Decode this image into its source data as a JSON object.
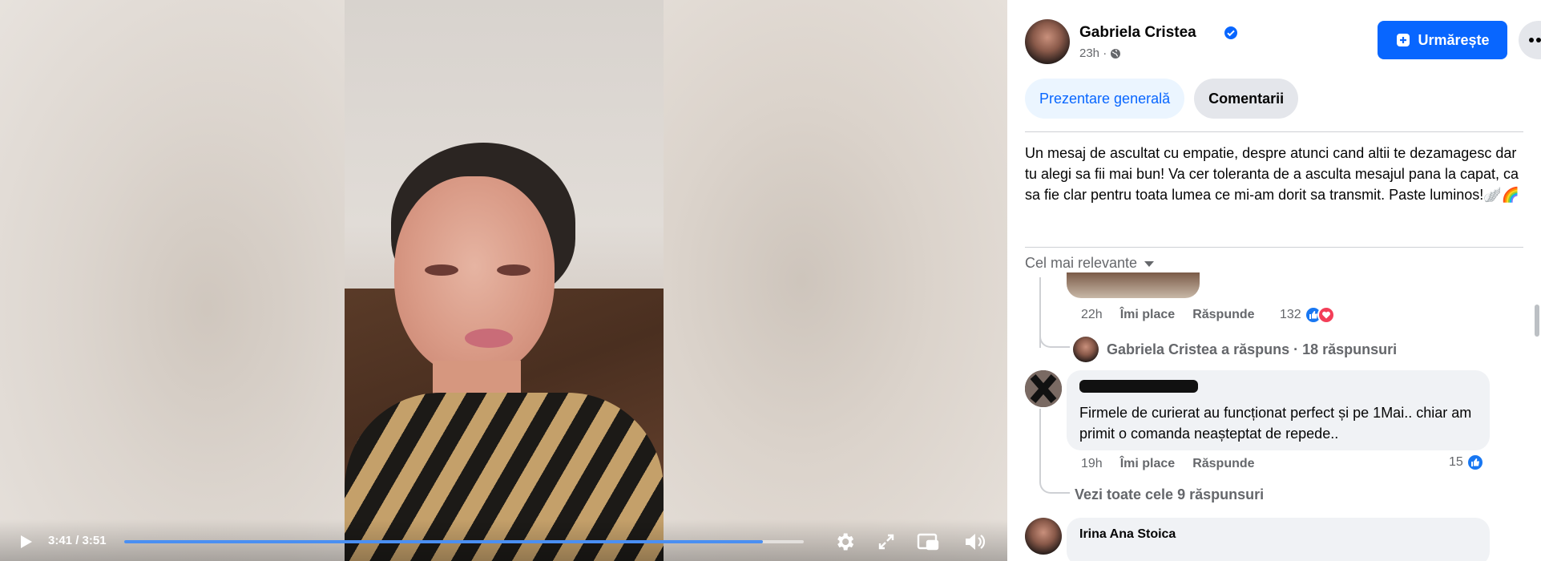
{
  "video": {
    "time_display": "3:41 / 3:51",
    "progress_fraction": 0.94,
    "controls": {
      "play": "play-icon",
      "settings": "gear-icon",
      "fullscreen": "fullscreen-icon",
      "pip": "picture-in-picture-icon",
      "volume": "volume-icon"
    }
  },
  "post": {
    "author": "Gabriela Cristea",
    "time": "23h ·",
    "follow_label": "Urmărește",
    "tabs": [
      "Prezentare generală",
      "Comentarii"
    ],
    "text": "Un mesaj de ascultat cu empatie, despre atunci cand altii te dezamagesc dar tu alegi sa fii mai bun! Va cer toleranta de a asculta mesajul pana la capat, ca sa fie clar pentru toata lumea ce mi-am dorit sa transmit. Paste luminos!🪽🌈",
    "sort_label": "Cel mai relevante"
  },
  "comments": {
    "c1": {
      "time": "22h",
      "like_label": "Îmi place",
      "reply_label": "Răspunde",
      "reaction_count": "132"
    },
    "reply_summary": "Gabriela Cristea a răspuns · 18 răspunsuri",
    "c2": {
      "text": "Firmele de curierat au funcționat perfect și pe 1Mai.. chiar am primit o comanda neașteptat de repede..",
      "time": "19h",
      "like_label": "Îmi place",
      "reply_label": "Răspunde",
      "reaction_count": "15"
    },
    "view_all_replies": "Vezi toate cele 9 răspunsuri",
    "c3": {
      "name": "Irina Ana Stoica"
    }
  },
  "colors": {
    "accent": "#0866ff",
    "progress": "#4a8ff2",
    "secondary_text": "#65676b",
    "bubble": "#f0f2f5"
  }
}
